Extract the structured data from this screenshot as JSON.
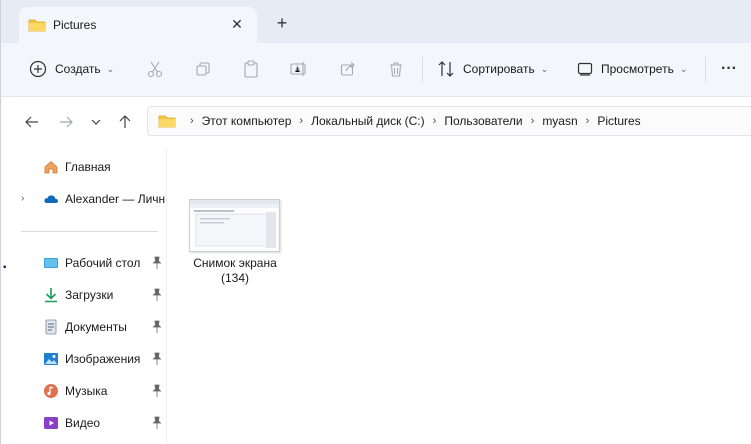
{
  "tab": {
    "title": "Pictures",
    "close": "✕",
    "new_tab": "+"
  },
  "commands": {
    "create": "Создать",
    "sort": "Сортировать",
    "view": "Просмотреть",
    "more": "···"
  },
  "nav": {
    "back": "←",
    "forward": "→",
    "recent": "⌄",
    "up": "↑"
  },
  "breadcrumb": [
    "Этот компьютер",
    "Локальный диск (C:)",
    "Пользователи",
    "myasn",
    "Pictures"
  ],
  "breadcrumb_sep": "›",
  "sidebar": {
    "home": "Главная",
    "onedrive": "Alexander — Личн",
    "quick": [
      {
        "label": "Рабочий стол",
        "icon": "desktop-icon"
      },
      {
        "label": "Загрузки",
        "icon": "downloads-icon"
      },
      {
        "label": "Документы",
        "icon": "documents-icon"
      },
      {
        "label": "Изображения",
        "icon": "pictures-icon"
      },
      {
        "label": "Музыка",
        "icon": "music-icon"
      },
      {
        "label": "Видео",
        "icon": "videos-icon"
      }
    ]
  },
  "files": [
    {
      "name_line1": "Снимок экрана",
      "name_line2": "(134)"
    }
  ],
  "colors": {
    "accent": "#0067c0",
    "folder": "#f4c543",
    "tabbar": "#e6ebf5",
    "cmdbar": "#f3f6fb"
  }
}
